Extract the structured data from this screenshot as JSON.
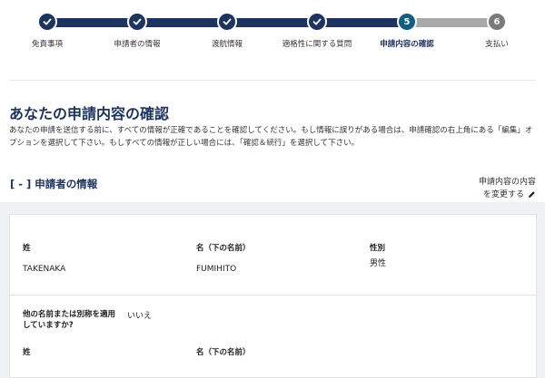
{
  "stepper": {
    "steps": [
      {
        "label": "免責事項",
        "state": "done",
        "number": ""
      },
      {
        "label": "申請者の情報",
        "state": "done",
        "number": ""
      },
      {
        "label": "渡航情報",
        "state": "done",
        "number": ""
      },
      {
        "label": "適格性に関する質問",
        "state": "done",
        "number": ""
      },
      {
        "label": "申請内容の確認",
        "state": "current",
        "number": "5"
      },
      {
        "label": "支払い",
        "state": "todo",
        "number": "6"
      }
    ],
    "colors": {
      "done": "#1d3461",
      "current": "#0f5e86",
      "todo": "#7a7a7a"
    }
  },
  "page": {
    "title": "あなたの申請内容の確認",
    "description": "あなたの申請を送信する前に、すべての情報が正確であることを確認してください。もし情報に誤りがある場合は、申請確認の右上角にある「編集」オプションを選択して下さい。もしすべての情報が正しい場合には、「確認＆続行」を選択して下さい。"
  },
  "section": {
    "title": "[ - ] 申請者の情報",
    "edit_line1": "申請内容の内容",
    "edit_line2": "を変更する",
    "edit_icon": "pencil-icon"
  },
  "applicant": {
    "surname_label": "姓",
    "surname_value": "TAKENAKA",
    "given_label": "名（下の名前）",
    "given_value": "FUMIHITO",
    "gender_label": "性別",
    "gender_value": "男性",
    "alias_question": "他の名前または別称を適用していますか?",
    "alias_answer": "いいえ",
    "alias_surname_label": "姓",
    "alias_given_label": "名（下の名前）"
  }
}
